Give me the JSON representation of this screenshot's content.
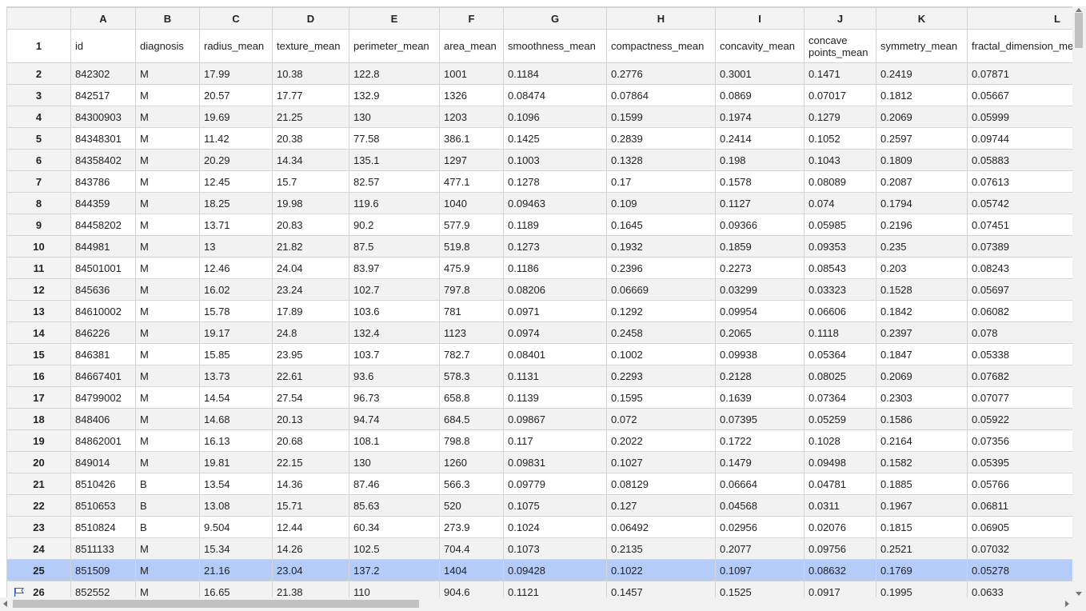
{
  "columns": [
    "A",
    "B",
    "C",
    "D",
    "E",
    "F",
    "G",
    "H",
    "I",
    "J",
    "K",
    "L"
  ],
  "header_row_number": "1",
  "headers": [
    "id",
    "diagnosis",
    "radius_mean",
    "texture_mean",
    "perimeter_mean",
    "area_mean",
    "smoothness_mean",
    "compactness_mean",
    "concavity_mean",
    "concave points_mean",
    "symmetry_mean",
    "fractal_dimension_mean"
  ],
  "selected_row": "25",
  "rows": [
    {
      "n": "2",
      "c": [
        "842302",
        "M",
        "17.99",
        "10.38",
        "122.8",
        "1001",
        "0.1184",
        "0.2776",
        "0.3001",
        "0.1471",
        "0.2419",
        "0.07871"
      ]
    },
    {
      "n": "3",
      "c": [
        "842517",
        "M",
        "20.57",
        "17.77",
        "132.9",
        "1326",
        "0.08474",
        "0.07864",
        "0.0869",
        "0.07017",
        "0.1812",
        "0.05667"
      ]
    },
    {
      "n": "4",
      "c": [
        "84300903",
        "M",
        "19.69",
        "21.25",
        "130",
        "1203",
        "0.1096",
        "0.1599",
        "0.1974",
        "0.1279",
        "0.2069",
        "0.05999"
      ]
    },
    {
      "n": "5",
      "c": [
        "84348301",
        "M",
        "11.42",
        "20.38",
        "77.58",
        "386.1",
        "0.1425",
        "0.2839",
        "0.2414",
        "0.1052",
        "0.2597",
        "0.09744"
      ]
    },
    {
      "n": "6",
      "c": [
        "84358402",
        "M",
        "20.29",
        "14.34",
        "135.1",
        "1297",
        "0.1003",
        "0.1328",
        "0.198",
        "0.1043",
        "0.1809",
        "0.05883"
      ]
    },
    {
      "n": "7",
      "c": [
        "843786",
        "M",
        "12.45",
        "15.7",
        "82.57",
        "477.1",
        "0.1278",
        "0.17",
        "0.1578",
        "0.08089",
        "0.2087",
        "0.07613"
      ]
    },
    {
      "n": "8",
      "c": [
        "844359",
        "M",
        "18.25",
        "19.98",
        "119.6",
        "1040",
        "0.09463",
        "0.109",
        "0.1127",
        "0.074",
        "0.1794",
        "0.05742"
      ]
    },
    {
      "n": "9",
      "c": [
        "84458202",
        "M",
        "13.71",
        "20.83",
        "90.2",
        "577.9",
        "0.1189",
        "0.1645",
        "0.09366",
        "0.05985",
        "0.2196",
        "0.07451"
      ]
    },
    {
      "n": "10",
      "c": [
        "844981",
        "M",
        "13",
        "21.82",
        "87.5",
        "519.8",
        "0.1273",
        "0.1932",
        "0.1859",
        "0.09353",
        "0.235",
        "0.07389"
      ]
    },
    {
      "n": "11",
      "c": [
        "84501001",
        "M",
        "12.46",
        "24.04",
        "83.97",
        "475.9",
        "0.1186",
        "0.2396",
        "0.2273",
        "0.08543",
        "0.203",
        "0.08243"
      ]
    },
    {
      "n": "12",
      "c": [
        "845636",
        "M",
        "16.02",
        "23.24",
        "102.7",
        "797.8",
        "0.08206",
        "0.06669",
        "0.03299",
        "0.03323",
        "0.1528",
        "0.05697"
      ]
    },
    {
      "n": "13",
      "c": [
        "84610002",
        "M",
        "15.78",
        "17.89",
        "103.6",
        "781",
        "0.0971",
        "0.1292",
        "0.09954",
        "0.06606",
        "0.1842",
        "0.06082"
      ]
    },
    {
      "n": "14",
      "c": [
        "846226",
        "M",
        "19.17",
        "24.8",
        "132.4",
        "1123",
        "0.0974",
        "0.2458",
        "0.2065",
        "0.1118",
        "0.2397",
        "0.078"
      ]
    },
    {
      "n": "15",
      "c": [
        "846381",
        "M",
        "15.85",
        "23.95",
        "103.7",
        "782.7",
        "0.08401",
        "0.1002",
        "0.09938",
        "0.05364",
        "0.1847",
        "0.05338"
      ]
    },
    {
      "n": "16",
      "c": [
        "84667401",
        "M",
        "13.73",
        "22.61",
        "93.6",
        "578.3",
        "0.1131",
        "0.2293",
        "0.2128",
        "0.08025",
        "0.2069",
        "0.07682"
      ]
    },
    {
      "n": "17",
      "c": [
        "84799002",
        "M",
        "14.54",
        "27.54",
        "96.73",
        "658.8",
        "0.1139",
        "0.1595",
        "0.1639",
        "0.07364",
        "0.2303",
        "0.07077"
      ]
    },
    {
      "n": "18",
      "c": [
        "848406",
        "M",
        "14.68",
        "20.13",
        "94.74",
        "684.5",
        "0.09867",
        "0.072",
        "0.07395",
        "0.05259",
        "0.1586",
        "0.05922"
      ]
    },
    {
      "n": "19",
      "c": [
        "84862001",
        "M",
        "16.13",
        "20.68",
        "108.1",
        "798.8",
        "0.117",
        "0.2022",
        "0.1722",
        "0.1028",
        "0.2164",
        "0.07356"
      ]
    },
    {
      "n": "20",
      "c": [
        "849014",
        "M",
        "19.81",
        "22.15",
        "130",
        "1260",
        "0.09831",
        "0.1027",
        "0.1479",
        "0.09498",
        "0.1582",
        "0.05395"
      ]
    },
    {
      "n": "21",
      "c": [
        "8510426",
        "B",
        "13.54",
        "14.36",
        "87.46",
        "566.3",
        "0.09779",
        "0.08129",
        "0.06664",
        "0.04781",
        "0.1885",
        "0.05766"
      ]
    },
    {
      "n": "22",
      "c": [
        "8510653",
        "B",
        "13.08",
        "15.71",
        "85.63",
        "520",
        "0.1075",
        "0.127",
        "0.04568",
        "0.0311",
        "0.1967",
        "0.06811"
      ]
    },
    {
      "n": "23",
      "c": [
        "8510824",
        "B",
        "9.504",
        "12.44",
        "60.34",
        "273.9",
        "0.1024",
        "0.06492",
        "0.02956",
        "0.02076",
        "0.1815",
        "0.06905"
      ]
    },
    {
      "n": "24",
      "c": [
        "8511133",
        "M",
        "15.34",
        "14.26",
        "102.5",
        "704.4",
        "0.1073",
        "0.2135",
        "0.2077",
        "0.09756",
        "0.2521",
        "0.07032"
      ]
    },
    {
      "n": "25",
      "c": [
        "851509",
        "M",
        "21.16",
        "23.04",
        "137.2",
        "1404",
        "0.09428",
        "0.1022",
        "0.1097",
        "0.08632",
        "0.1769",
        "0.05278"
      ]
    },
    {
      "n": "26",
      "c": [
        "852552",
        "M",
        "16.65",
        "21.38",
        "110",
        "904.6",
        "0.1121",
        "0.1457",
        "0.1525",
        "0.0917",
        "0.1995",
        "0.0633"
      ]
    }
  ]
}
